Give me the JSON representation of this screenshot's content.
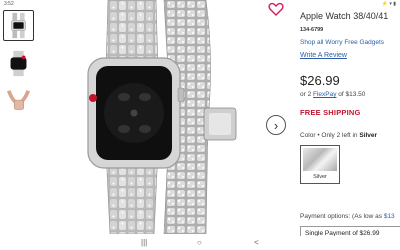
{
  "status_bar": {
    "time": "3:52",
    "icons": "⚡ ▾ ▮"
  },
  "product": {
    "title": "Apple Watch 38/40/41",
    "sku": "134-6799",
    "shop_link": "Shop all Worry Free Gadgets",
    "review_link": "Write A Review",
    "price": "$26.99",
    "flexpay_prefix": "or 2 ",
    "flexpay_link": "FlexPay",
    "flexpay_suffix": " of $13.50",
    "free_shipping": "FREE SHIPPING",
    "color_prefix": "Color • Only 2 left in ",
    "color_value": "Silver",
    "swatch_label": "Silver",
    "payment_options_prefix": "Payment options: (As low as ",
    "payment_options_value": "$13",
    "single_payment": "Single Payment of $26.99"
  },
  "nav": {
    "recent": "|||",
    "home": "○",
    "back": "<"
  },
  "icons": {
    "heart": "heart-icon",
    "next": "chevron-right-icon"
  },
  "colors": {
    "link": "#2a5fa8",
    "shipping": "#c0152f",
    "heart": "#d81b60"
  }
}
